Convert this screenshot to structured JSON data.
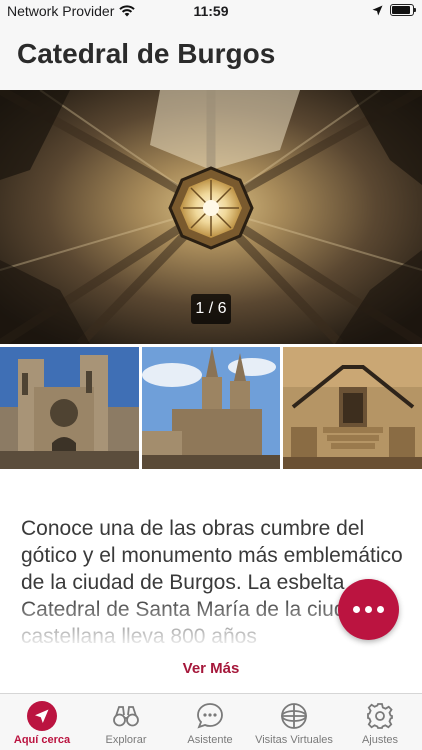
{
  "status_bar": {
    "carrier": "Network Provider",
    "time": "11:59",
    "battery_level": 0.9
  },
  "header": {
    "title": "Catedral de Burgos"
  },
  "gallery": {
    "counter": "1 / 6",
    "current": 1,
    "total": 6
  },
  "description": {
    "text": "Conoce una de las obras cumbre del gótico y el monumento más emblemático de la ciudad de Burgos. La esbelta Catedral de Santa María de la ciudad castellana lleva 800 años",
    "see_more": "Ver Más"
  },
  "tabs": [
    {
      "label": "Aquí cerca",
      "icon": "navigation-arrow-icon",
      "active": true
    },
    {
      "label": "Explorar",
      "icon": "binoculars-icon",
      "active": false
    },
    {
      "label": "Asistente",
      "icon": "chat-bubble-icon",
      "active": false
    },
    {
      "label": "Visitas Virtuales",
      "icon": "globe-icon",
      "active": false
    },
    {
      "label": "Ajustes",
      "icon": "gear-icon",
      "active": false
    }
  ],
  "colors": {
    "accent": "#bb1440",
    "link": "#a5173a"
  }
}
